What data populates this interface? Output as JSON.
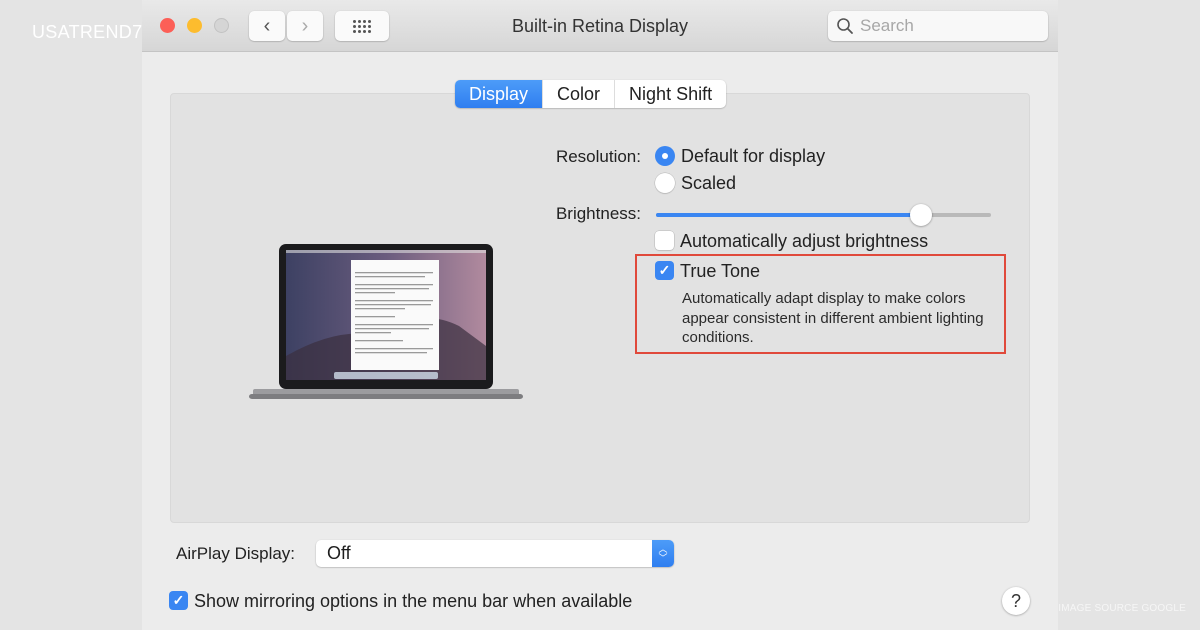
{
  "watermark": "USATREND7.",
  "image_source": "IMAGE SOURCE GOOGLE",
  "window": {
    "title": "Built-in Retina Display",
    "search_placeholder": "Search",
    "nav": {
      "back_icon": "‹",
      "forward_icon": "›"
    }
  },
  "tabs": [
    {
      "label": "Display",
      "active": true
    },
    {
      "label": "Color",
      "active": false
    },
    {
      "label": "Night Shift",
      "active": false
    }
  ],
  "resolution": {
    "label": "Resolution:",
    "options": [
      {
        "label": "Default for display",
        "selected": true
      },
      {
        "label": "Scaled",
        "selected": false
      }
    ]
  },
  "brightness": {
    "label": "Brightness:",
    "value": 0.79,
    "auto_adjust": {
      "label": "Automatically adjust brightness",
      "checked": false
    }
  },
  "true_tone": {
    "label": "True Tone",
    "checked": true,
    "description": "Automatically adapt display to make colors appear consistent in different ambient lighting conditions."
  },
  "airplay": {
    "label": "AirPlay Display:",
    "value": "Off"
  },
  "mirroring": {
    "label": "Show mirroring options in the menu bar when available",
    "checked": true
  },
  "help_label": "?",
  "colors": {
    "accent": "#3a86f2",
    "highlight_box": "#e0493b"
  }
}
